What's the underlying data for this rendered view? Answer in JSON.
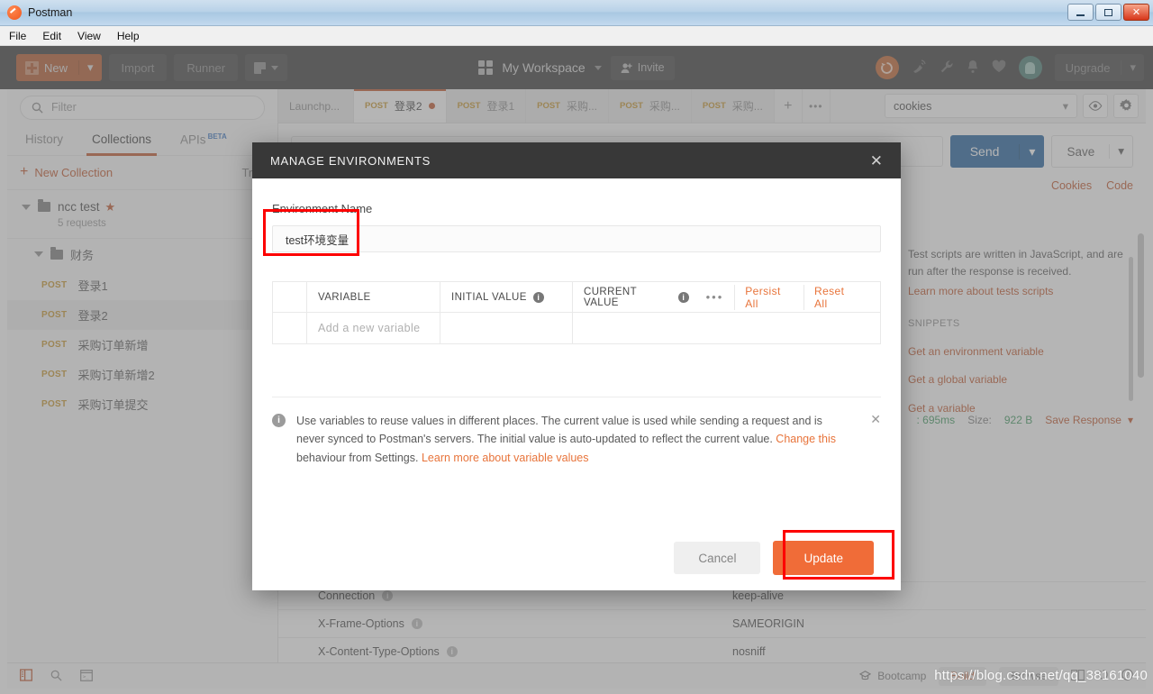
{
  "window": {
    "title": "Postman",
    "app_icon": "postman-logo-icon",
    "minimize": "–",
    "maximize": "❑",
    "close": "✕"
  },
  "menubar": {
    "items": [
      "File",
      "Edit",
      "View",
      "Help"
    ]
  },
  "header": {
    "new_label": "New",
    "new_caret": "▾",
    "import_label": "Import",
    "runner_label": "Runner",
    "workspace_name": "My Workspace",
    "workspace_caret": "▾",
    "invite_label": "Invite",
    "invite_icon": "person-add-icon",
    "sync_icon": "sync-icon",
    "satellite_icon": "satellite-icon",
    "wrench_icon": "wrench-icon",
    "bell_icon": "bell-icon",
    "heart_icon": "heart-icon",
    "avatar_icon": "user-avatar-icon",
    "upgrade_label": "Upgrade",
    "upgrade_caret": "▾"
  },
  "sidebar": {
    "filter_placeholder": "Filter",
    "search_icon": "search-icon",
    "tabs": [
      {
        "label": "History",
        "active": false
      },
      {
        "label": "Collections",
        "active": true
      },
      {
        "label": "APIs",
        "badge": "BETA",
        "active": false
      }
    ],
    "new_collection_label": "New Collection",
    "trash_label": "Tras",
    "collection": {
      "name": "ncc test",
      "star": "★",
      "subtitle": "5 requests",
      "folder": "财务",
      "requests": [
        {
          "method": "POST",
          "name": "登录1",
          "selected": false
        },
        {
          "method": "POST",
          "name": "登录2",
          "selected": true
        },
        {
          "method": "POST",
          "name": "采购订单新增",
          "selected": false
        },
        {
          "method": "POST",
          "name": "采购订单新增2",
          "selected": false
        },
        {
          "method": "POST",
          "name": "采购订单提交",
          "selected": false
        }
      ]
    }
  },
  "main": {
    "tabs": [
      {
        "label": "Launchp...",
        "method": "",
        "active": false,
        "dirty": false
      },
      {
        "label": "登录2",
        "method": "POST",
        "active": true,
        "dirty": true
      },
      {
        "label": "登录1",
        "method": "POST",
        "active": false,
        "dirty": false
      },
      {
        "label": "采购...",
        "method": "POST",
        "active": false,
        "dirty": false
      },
      {
        "label": "采购...",
        "method": "POST",
        "active": false,
        "dirty": false
      },
      {
        "label": "采购...",
        "method": "POST",
        "active": false,
        "dirty": false
      }
    ],
    "add_tab": "+",
    "tab_more": "•••",
    "environment_selected": "cookies",
    "environment_caret": "▾",
    "eye_icon": "eye-icon",
    "gear_icon": "gear-icon",
    "send_label": "Send",
    "send_caret": "▾",
    "save_label": "Save",
    "save_caret": "▾",
    "cookies_link": "Cookies",
    "code_link": "Code",
    "tests": {
      "description": "Test scripts are written in JavaScript, and are run after the response is received.",
      "learn_more": "Learn more about tests scripts",
      "snippets_title": "SNIPPETS",
      "snippets": [
        "Get an environment variable",
        "Get a global variable",
        "Get a variable"
      ]
    },
    "response_meta": {
      "time_prefix": ":",
      "time": "695ms",
      "size_label": "Size:",
      "size": "922 B",
      "save_response": "Save Response",
      "save_response_caret": "▾"
    },
    "headers_table": [
      {
        "name": "Connection",
        "value": "keep-alive"
      },
      {
        "name": "X-Frame-Options",
        "value": "SAMEORIGIN"
      },
      {
        "name": "X-Content-Type-Options",
        "value": "nosniff"
      }
    ]
  },
  "modal": {
    "title": "MANAGE ENVIRONMENTS",
    "close_icon": "close-icon",
    "field_label": "Environment Name",
    "env_name_value": "test环境变量",
    "table": {
      "headers": [
        "VARIABLE",
        "INITIAL VALUE",
        "CURRENT VALUE"
      ],
      "info_icon": "info-icon",
      "more_icon": "•••",
      "persist_all": "Persist All",
      "reset_all": "Reset All",
      "new_row_placeholder": "Add a new variable"
    },
    "note": {
      "icon": "info-icon",
      "text_1": "Use variables to reuse values in different places. The current value is used while sending a request and is never synced to Postman's servers. The initial value is auto-updated to reflect the current value. ",
      "link_1": "Change this",
      "text_2": " behaviour from Settings. ",
      "link_2": "Learn more about variable values",
      "dismiss": "✕"
    },
    "cancel_label": "Cancel",
    "update_label": "Update"
  },
  "statusbar": {
    "sidebar_toggle_icon": "sidebar-toggle-icon",
    "search_icon": "search-icon",
    "console_icon": "console-icon",
    "bootcamp_icon": "bootcamp-icon",
    "bootcamp_label": "Bootcamp",
    "build_label": "Build",
    "browse_label": "Browse",
    "windows_icon": "two-pane-icon",
    "sync_status_icon": "sync-status-icon",
    "help_icon": "help-icon"
  },
  "watermark": "https://blog.csdn.net/qq_38161040",
  "colors": {
    "accent_orange": "#c1552a",
    "update_orange": "#f06c38",
    "send_blue": "#1f5f9e",
    "header_dark": "#383838",
    "annotation_red": "#fd0000",
    "method_post": "#c8952a"
  }
}
